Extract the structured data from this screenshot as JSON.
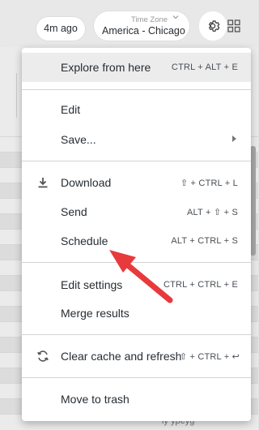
{
  "header": {
    "last_updated": "4m ago",
    "timezone_label": "Time Zone",
    "timezone_value": "America - Chicago"
  },
  "menu": {
    "explore": {
      "label": "Explore from here",
      "shortcut": "CTRL + ALT + E"
    },
    "edit": {
      "label": "Edit"
    },
    "save": {
      "label": "Save..."
    },
    "download": {
      "label": "Download",
      "shortcut": "⇧ + CTRL + L"
    },
    "send": {
      "label": "Send",
      "shortcut": "ALT + ⇧ + S"
    },
    "schedule": {
      "label": "Schedule",
      "shortcut": "ALT + CTRL + S"
    },
    "edit_settings": {
      "label": "Edit settings",
      "shortcut": "CTRL + CTRL + E"
    },
    "merge_results": {
      "label": "Merge results"
    },
    "clear_cache": {
      "label": "Clear cache and refresh",
      "shortcut": "⇧ + CTRL + ↩"
    },
    "move_to_trash": {
      "label": "Move to trash"
    }
  },
  "colors": {
    "annotation_arrow": "#e8393c",
    "menu_hover": "#ececec",
    "background": "#e3e3e3"
  },
  "icons": {
    "download": "download-icon",
    "clear_cache": "refresh-icon",
    "settings": "gear-icon",
    "apps": "grid-icon",
    "timezone_dropdown": "chevron-down-icon",
    "save_submenu": "chevron-right-icon"
  },
  "background_table": {
    "bottom_cell_text": "ly ypeyg"
  }
}
